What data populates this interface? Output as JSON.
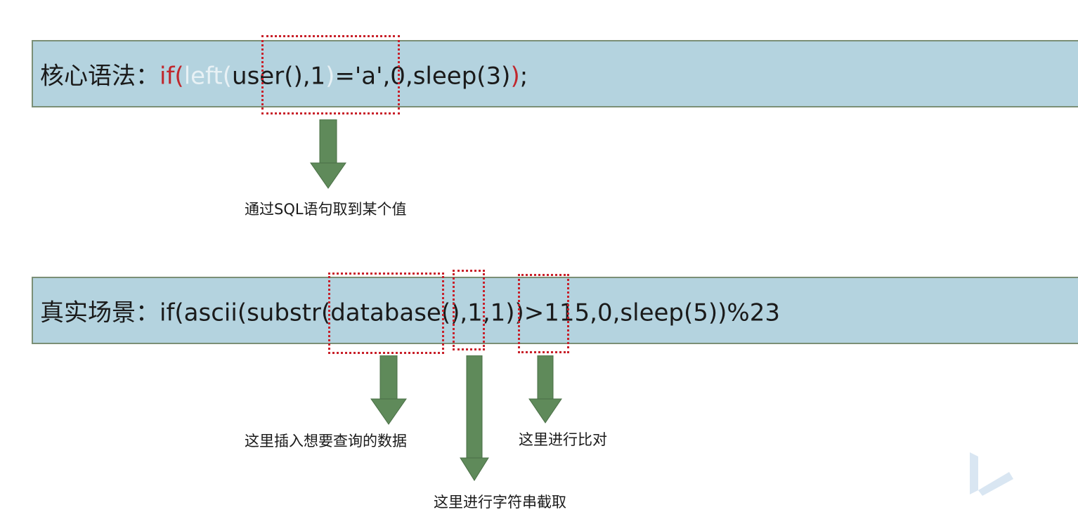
{
  "row1": {
    "label": "核心语法：",
    "code_part1": "if(",
    "code_part2": "left(",
    "code_part3": "user(),1",
    "code_part4": ")",
    "code_part5": "='a',0,sleep(3)",
    "code_part6": ")",
    "code_part7": ";"
  },
  "row2": {
    "label": "真实场景：",
    "code": "if(ascii(substr(database(),1,1))>115,0,sleep(5))%23"
  },
  "captions": {
    "get_value": "通过SQL语句取到某个值",
    "insert_data": "这里插入想要查询的数据",
    "substring": "这里进行字符串截取",
    "compare": "这里进行比对"
  },
  "colors": {
    "bar_fill": "#b4d3df",
    "arrow_fill": "#5f8a5a",
    "dash_box": "#c8202a",
    "code_red": "#c0272d"
  },
  "icons": {
    "logo": "watermark-logo-icon"
  }
}
